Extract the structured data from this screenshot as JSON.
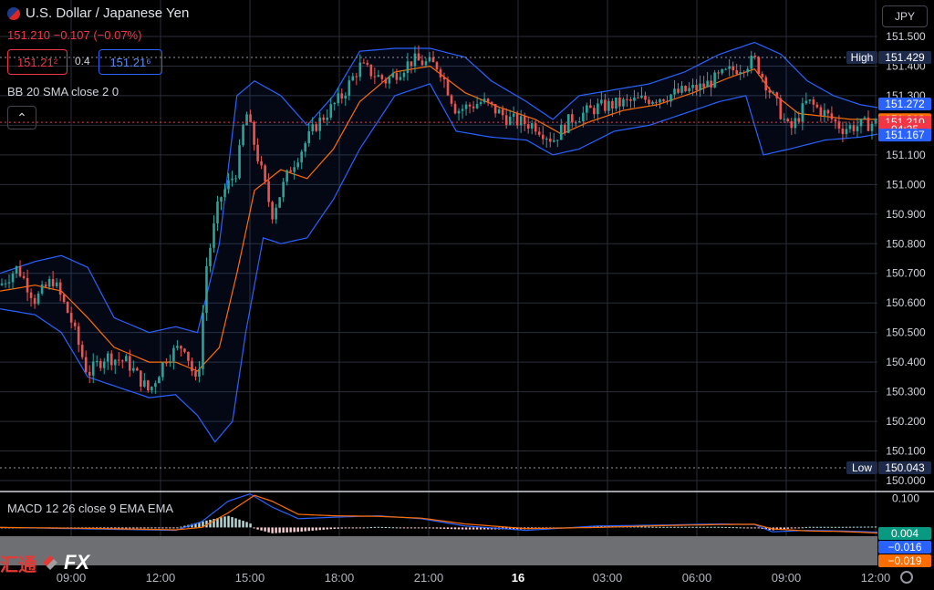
{
  "header": {
    "symbol_title": "U.S. Dollar / Japanese Yen",
    "quote_line": "151.210 −0.107 (−0.07%)",
    "bid": "151.21²",
    "spread": "0.4",
    "ask": "151.21⁶",
    "currency_selector": "JPY",
    "collapse_icon": "chevron-up-icon"
  },
  "indicators": {
    "bb_label": "BB 20 SMA close 2 0",
    "macd_label": "MACD 12 26 close 9 EMA EMA"
  },
  "logo": {
    "cn_text": "汇通",
    "fx_text": "FX"
  },
  "colors": {
    "up": "#26a69a",
    "down": "#ef5350",
    "bb_band": "#2962ff",
    "bb_basis": "#ff6d00",
    "macd_line": "#2962ff",
    "signal_line": "#ff6d00",
    "current_price": "#f23645"
  },
  "chart_data": [
    {
      "type": "candlestick",
      "title": "U.S. Dollar / Japanese Yen",
      "ylim": [
        150.0,
        151.55
      ],
      "y_ticks": [
        "151.500",
        "151.400",
        "151.300",
        "151.200",
        "151.100",
        "151.000",
        "150.900",
        "150.800",
        "150.700",
        "150.600",
        "150.500",
        "150.400",
        "150.300",
        "150.200",
        "150.100",
        "150.000"
      ],
      "x_ticks": [
        "09:00",
        "12:00",
        "15:00",
        "18:00",
        "21:00",
        "16",
        "03:00",
        "06:00",
        "09:00",
        "12:00"
      ],
      "price_labels": [
        {
          "label": "High",
          "value": "151.429",
          "v": 151.429,
          "kind": "hl"
        },
        {
          "label": "",
          "value": "151.272",
          "v": 151.272,
          "kind": "blue"
        },
        {
          "label": "",
          "value": "151.219",
          "v": 151.219,
          "kind": "orange"
        },
        {
          "label": "",
          "value": "151.210",
          "v": 151.21,
          "kind": "red"
        },
        {
          "label": "",
          "value": "04:25",
          "v": 151.186,
          "kind": "red"
        },
        {
          "label": "",
          "value": "151.167",
          "v": 151.167,
          "kind": "blue"
        },
        {
          "label": "Low",
          "value": "150.043",
          "v": 150.043,
          "kind": "hl"
        }
      ],
      "close_path": [
        {
          "x": 0,
          "y": 150.66
        },
        {
          "x": 0.02,
          "y": 150.72
        },
        {
          "x": 0.04,
          "y": 150.61
        },
        {
          "x": 0.06,
          "y": 150.68
        },
        {
          "x": 0.08,
          "y": 150.55
        },
        {
          "x": 0.1,
          "y": 150.36
        },
        {
          "x": 0.12,
          "y": 150.42
        },
        {
          "x": 0.145,
          "y": 150.4
        },
        {
          "x": 0.17,
          "y": 150.3
        },
        {
          "x": 0.19,
          "y": 150.42
        },
        {
          "x": 0.21,
          "y": 150.46
        },
        {
          "x": 0.225,
          "y": 150.31
        },
        {
          "x": 0.235,
          "y": 150.72
        },
        {
          "x": 0.25,
          "y": 150.95
        },
        {
          "x": 0.27,
          "y": 151.05
        },
        {
          "x": 0.28,
          "y": 151.25
        },
        {
          "x": 0.3,
          "y": 151.02
        },
        {
          "x": 0.31,
          "y": 150.9
        },
        {
          "x": 0.33,
          "y": 151.05
        },
        {
          "x": 0.36,
          "y": 151.2
        },
        {
          "x": 0.39,
          "y": 151.3
        },
        {
          "x": 0.41,
          "y": 151.4
        },
        {
          "x": 0.44,
          "y": 151.35
        },
        {
          "x": 0.47,
          "y": 151.42
        },
        {
          "x": 0.5,
          "y": 151.4
        },
        {
          "x": 0.52,
          "y": 151.25
        },
        {
          "x": 0.55,
          "y": 151.28
        },
        {
          "x": 0.58,
          "y": 151.22
        },
        {
          "x": 0.61,
          "y": 151.2
        },
        {
          "x": 0.63,
          "y": 151.15
        },
        {
          "x": 0.65,
          "y": 151.22
        },
        {
          "x": 0.68,
          "y": 151.26
        },
        {
          "x": 0.72,
          "y": 151.28
        },
        {
          "x": 0.76,
          "y": 151.3
        },
        {
          "x": 0.8,
          "y": 151.33
        },
        {
          "x": 0.83,
          "y": 151.38
        },
        {
          "x": 0.86,
          "y": 151.42
        },
        {
          "x": 0.88,
          "y": 151.3
        },
        {
          "x": 0.9,
          "y": 151.18
        },
        {
          "x": 0.92,
          "y": 151.28
        },
        {
          "x": 0.94,
          "y": 151.24
        },
        {
          "x": 0.96,
          "y": 151.19
        },
        {
          "x": 0.98,
          "y": 151.2
        },
        {
          "x": 1.0,
          "y": 151.21
        }
      ],
      "bb_upper": [
        {
          "x": 0,
          "y": 150.7
        },
        {
          "x": 0.04,
          "y": 150.74
        },
        {
          "x": 0.07,
          "y": 150.76
        },
        {
          "x": 0.1,
          "y": 150.72
        },
        {
          "x": 0.13,
          "y": 150.55
        },
        {
          "x": 0.17,
          "y": 150.5
        },
        {
          "x": 0.2,
          "y": 150.52
        },
        {
          "x": 0.225,
          "y": 150.5
        },
        {
          "x": 0.25,
          "y": 150.8
        },
        {
          "x": 0.27,
          "y": 151.3
        },
        {
          "x": 0.29,
          "y": 151.35
        },
        {
          "x": 0.32,
          "y": 151.3
        },
        {
          "x": 0.35,
          "y": 151.2
        },
        {
          "x": 0.38,
          "y": 151.3
        },
        {
          "x": 0.41,
          "y": 151.45
        },
        {
          "x": 0.45,
          "y": 151.46
        },
        {
          "x": 0.49,
          "y": 151.46
        },
        {
          "x": 0.53,
          "y": 151.43
        },
        {
          "x": 0.56,
          "y": 151.35
        },
        {
          "x": 0.6,
          "y": 151.28
        },
        {
          "x": 0.63,
          "y": 151.22
        },
        {
          "x": 0.66,
          "y": 151.3
        },
        {
          "x": 0.7,
          "y": 151.32
        },
        {
          "x": 0.74,
          "y": 151.34
        },
        {
          "x": 0.78,
          "y": 151.38
        },
        {
          "x": 0.82,
          "y": 151.44
        },
        {
          "x": 0.86,
          "y": 151.48
        },
        {
          "x": 0.89,
          "y": 151.44
        },
        {
          "x": 0.92,
          "y": 151.35
        },
        {
          "x": 0.95,
          "y": 151.3
        },
        {
          "x": 0.98,
          "y": 151.27
        },
        {
          "x": 1.0,
          "y": 151.26
        }
      ],
      "bb_lower": [
        {
          "x": 0,
          "y": 150.58
        },
        {
          "x": 0.04,
          "y": 150.56
        },
        {
          "x": 0.07,
          "y": 150.5
        },
        {
          "x": 0.1,
          "y": 150.35
        },
        {
          "x": 0.13,
          "y": 150.32
        },
        {
          "x": 0.17,
          "y": 150.28
        },
        {
          "x": 0.2,
          "y": 150.29
        },
        {
          "x": 0.225,
          "y": 150.22
        },
        {
          "x": 0.245,
          "y": 150.13
        },
        {
          "x": 0.265,
          "y": 150.2
        },
        {
          "x": 0.28,
          "y": 150.5
        },
        {
          "x": 0.3,
          "y": 150.82
        },
        {
          "x": 0.32,
          "y": 150.8
        },
        {
          "x": 0.35,
          "y": 150.82
        },
        {
          "x": 0.38,
          "y": 150.95
        },
        {
          "x": 0.41,
          "y": 151.12
        },
        {
          "x": 0.45,
          "y": 151.3
        },
        {
          "x": 0.49,
          "y": 151.34
        },
        {
          "x": 0.52,
          "y": 151.18
        },
        {
          "x": 0.56,
          "y": 151.16
        },
        {
          "x": 0.6,
          "y": 151.15
        },
        {
          "x": 0.63,
          "y": 151.1
        },
        {
          "x": 0.66,
          "y": 151.12
        },
        {
          "x": 0.7,
          "y": 151.18
        },
        {
          "x": 0.74,
          "y": 151.2
        },
        {
          "x": 0.78,
          "y": 151.24
        },
        {
          "x": 0.82,
          "y": 151.28
        },
        {
          "x": 0.85,
          "y": 151.3
        },
        {
          "x": 0.87,
          "y": 151.1
        },
        {
          "x": 0.9,
          "y": 151.12
        },
        {
          "x": 0.94,
          "y": 151.15
        },
        {
          "x": 0.98,
          "y": 151.16
        },
        {
          "x": 1.0,
          "y": 151.17
        }
      ],
      "bb_basis": [
        {
          "x": 0,
          "y": 150.64
        },
        {
          "x": 0.04,
          "y": 150.66
        },
        {
          "x": 0.07,
          "y": 150.64
        },
        {
          "x": 0.1,
          "y": 150.55
        },
        {
          "x": 0.13,
          "y": 150.45
        },
        {
          "x": 0.17,
          "y": 150.4
        },
        {
          "x": 0.2,
          "y": 150.4
        },
        {
          "x": 0.225,
          "y": 150.37
        },
        {
          "x": 0.25,
          "y": 150.45
        },
        {
          "x": 0.27,
          "y": 150.7
        },
        {
          "x": 0.29,
          "y": 150.98
        },
        {
          "x": 0.32,
          "y": 151.05
        },
        {
          "x": 0.35,
          "y": 151.02
        },
        {
          "x": 0.38,
          "y": 151.12
        },
        {
          "x": 0.41,
          "y": 151.28
        },
        {
          "x": 0.45,
          "y": 151.38
        },
        {
          "x": 0.49,
          "y": 151.4
        },
        {
          "x": 0.53,
          "y": 151.31
        },
        {
          "x": 0.57,
          "y": 151.26
        },
        {
          "x": 0.61,
          "y": 151.22
        },
        {
          "x": 0.64,
          "y": 151.17
        },
        {
          "x": 0.67,
          "y": 151.21
        },
        {
          "x": 0.71,
          "y": 151.25
        },
        {
          "x": 0.75,
          "y": 151.27
        },
        {
          "x": 0.79,
          "y": 151.31
        },
        {
          "x": 0.83,
          "y": 151.36
        },
        {
          "x": 0.86,
          "y": 151.39
        },
        {
          "x": 0.88,
          "y": 151.31
        },
        {
          "x": 0.91,
          "y": 151.24
        },
        {
          "x": 0.94,
          "y": 151.23
        },
        {
          "x": 0.97,
          "y": 151.22
        },
        {
          "x": 1.0,
          "y": 151.22
        }
      ]
    },
    {
      "type": "line",
      "title": "MACD 12 26 close 9 EMA EMA",
      "ylim": [
        -0.03,
        0.12
      ],
      "y_ticks": [
        "0.100"
      ],
      "value_labels": [
        {
          "value": "0.004",
          "v": 0.004,
          "color": "#089981"
        },
        {
          "value": "−0.016",
          "v": -0.016,
          "color": "#2962ff"
        },
        {
          "value": "−0.019",
          "v": -0.019,
          "color": "#ff6d00"
        }
      ],
      "macd_line": [
        {
          "x": 0,
          "y": 0.0
        },
        {
          "x": 0.1,
          "y": -0.005
        },
        {
          "x": 0.2,
          "y": -0.01
        },
        {
          "x": 0.23,
          "y": 0.02
        },
        {
          "x": 0.26,
          "y": 0.09
        },
        {
          "x": 0.285,
          "y": 0.115
        },
        {
          "x": 0.31,
          "y": 0.07
        },
        {
          "x": 0.34,
          "y": 0.03
        },
        {
          "x": 0.38,
          "y": 0.035
        },
        {
          "x": 0.43,
          "y": 0.04
        },
        {
          "x": 0.48,
          "y": 0.03
        },
        {
          "x": 0.53,
          "y": 0.005
        },
        {
          "x": 0.6,
          "y": -0.01
        },
        {
          "x": 0.68,
          "y": 0.005
        },
        {
          "x": 0.75,
          "y": 0.008
        },
        {
          "x": 0.82,
          "y": 0.012
        },
        {
          "x": 0.86,
          "y": 0.01
        },
        {
          "x": 0.88,
          "y": -0.015
        },
        {
          "x": 0.92,
          "y": -0.01
        },
        {
          "x": 0.96,
          "y": -0.012
        },
        {
          "x": 1.0,
          "y": -0.016
        }
      ],
      "signal_line": [
        {
          "x": 0,
          "y": 0.0
        },
        {
          "x": 0.1,
          "y": -0.003
        },
        {
          "x": 0.2,
          "y": -0.008
        },
        {
          "x": 0.23,
          "y": 0.0
        },
        {
          "x": 0.26,
          "y": 0.05
        },
        {
          "x": 0.29,
          "y": 0.11
        },
        {
          "x": 0.31,
          "y": 0.09
        },
        {
          "x": 0.34,
          "y": 0.045
        },
        {
          "x": 0.38,
          "y": 0.04
        },
        {
          "x": 0.43,
          "y": 0.038
        },
        {
          "x": 0.48,
          "y": 0.032
        },
        {
          "x": 0.53,
          "y": 0.012
        },
        {
          "x": 0.6,
          "y": -0.004
        },
        {
          "x": 0.68,
          "y": 0.0
        },
        {
          "x": 0.75,
          "y": 0.006
        },
        {
          "x": 0.82,
          "y": 0.01
        },
        {
          "x": 0.86,
          "y": 0.011
        },
        {
          "x": 0.88,
          "y": -0.005
        },
        {
          "x": 0.92,
          "y": -0.012
        },
        {
          "x": 0.96,
          "y": -0.014
        },
        {
          "x": 1.0,
          "y": -0.019
        }
      ]
    }
  ]
}
